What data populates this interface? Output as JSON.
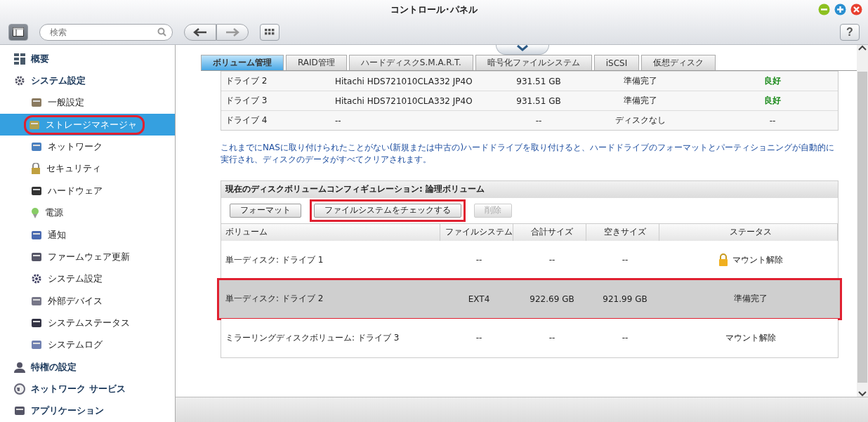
{
  "window": {
    "title": "コントロール･パネル"
  },
  "toolbar": {
    "search": {
      "placeholder": "検索"
    },
    "help": "?"
  },
  "sidebar": {
    "items": [
      {
        "kind": "group",
        "label": "概要",
        "selected": false,
        "annotated": false
      },
      {
        "kind": "group",
        "label": "システム設定",
        "selected": false,
        "annotated": false
      },
      {
        "kind": "item",
        "label": "一般設定",
        "selected": false,
        "annotated": false
      },
      {
        "kind": "item",
        "label": "ストレージマネージャ",
        "selected": true,
        "annotated": true
      },
      {
        "kind": "item",
        "label": "ネットワーク",
        "selected": false,
        "annotated": false
      },
      {
        "kind": "item",
        "label": "セキュリティ",
        "selected": false,
        "annotated": false
      },
      {
        "kind": "item",
        "label": "ハードウェア",
        "selected": false,
        "annotated": false
      },
      {
        "kind": "item",
        "label": "電源",
        "selected": false,
        "annotated": false
      },
      {
        "kind": "item",
        "label": "通知",
        "selected": false,
        "annotated": false
      },
      {
        "kind": "item",
        "label": "ファームウェア更新",
        "selected": false,
        "annotated": false
      },
      {
        "kind": "item",
        "label": "システム設定",
        "selected": false,
        "annotated": false
      },
      {
        "kind": "item",
        "label": "外部デバイス",
        "selected": false,
        "annotated": false
      },
      {
        "kind": "item",
        "label": "システムステータス",
        "selected": false,
        "annotated": false
      },
      {
        "kind": "item",
        "label": "システムログ",
        "selected": false,
        "annotated": false
      },
      {
        "kind": "group",
        "label": "特権の設定",
        "selected": false,
        "annotated": false
      },
      {
        "kind": "group",
        "label": "ネットワーク サービス",
        "selected": false,
        "annotated": false
      },
      {
        "kind": "group",
        "label": "アプリケーション",
        "selected": false,
        "annotated": false
      }
    ]
  },
  "tabs": [
    {
      "label": "ボリューム管理",
      "selected": true
    },
    {
      "label": "RAID管理",
      "selected": false
    },
    {
      "label": "ハードディスクS.M.A.R.T.",
      "selected": false
    },
    {
      "label": "暗号化ファイルシステム",
      "selected": false
    },
    {
      "label": "iSCSI",
      "selected": false
    },
    {
      "label": "仮想ディスク",
      "selected": false
    }
  ],
  "disks": {
    "rows": [
      {
        "name": "ドライブ 2",
        "model": "Hitachi HDS721010CLA332 JP4O",
        "capacity": "931.51 GB",
        "status": "準備完了",
        "health": "良好",
        "healthy": true
      },
      {
        "name": "ドライブ 3",
        "model": "Hitachi HDS721010CLA332 JP4O",
        "capacity": "931.51 GB",
        "status": "準備完了",
        "health": "良好",
        "healthy": true
      },
      {
        "name": "ドライブ 4",
        "model": "--",
        "capacity": "--",
        "status": "ディスクなし",
        "health": "--",
        "healthy": false
      }
    ]
  },
  "note": "これまでにNASに取り付けられたことがない(新規または中古の)ハードドライブを取り付けると、ハードドライブのフォーマットとパーティショニングが自動的に実行され、ディスクのデータがすべてクリアされます。",
  "volumes": {
    "title": "現在のディスクボリュームコンフィギュレーション: 論理ボリューム",
    "buttons": [
      {
        "label": "フォーマット",
        "disabled": false,
        "annotated": false
      },
      {
        "label": "ファイルシステムをチェックする",
        "disabled": false,
        "annotated": true
      },
      {
        "label": "削除",
        "disabled": true,
        "annotated": false
      }
    ],
    "columns": [
      "ボリューム",
      "ファイルシステム",
      "合計サイズ",
      "空きサイズ",
      "ステータス"
    ],
    "rows": [
      {
        "volume": "単一ディスク: ドライブ 1",
        "filesystem": "--",
        "total": "--",
        "free": "--",
        "status": "マウント解除",
        "locked": true,
        "selected": false,
        "annotated": false
      },
      {
        "volume": "単一ディスク: ドライブ 2",
        "filesystem": "EXT4",
        "total": "922.69 GB",
        "free": "921.99 GB",
        "status": "準備完了",
        "locked": false,
        "selected": true,
        "annotated": true
      },
      {
        "volume": "ミラーリングディスクボリューム: ドライブ 3",
        "filesystem": "--",
        "total": "--",
        "free": "--",
        "status": "マウント解除",
        "locked": false,
        "selected": false,
        "annotated": false
      }
    ]
  }
}
